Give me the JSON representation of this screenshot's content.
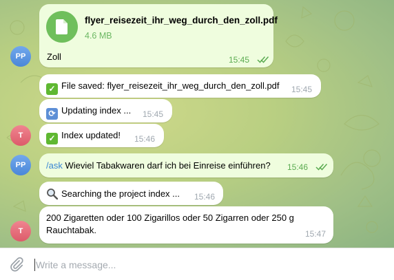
{
  "messages": {
    "file": {
      "filename": "flyer_reisezeit_ihr_weg_durch_den_zoll.pdf",
      "size": "4.6 MB",
      "caption": "Zoll",
      "time": "15:45",
      "avatar": "PP"
    },
    "saved": {
      "text": "File saved: flyer_reisezeit_ihr_weg_durch_den_zoll.pdf",
      "time": "15:45"
    },
    "updating": {
      "text": "Updating index ...",
      "time": "15:45"
    },
    "updated": {
      "text": "Index updated!",
      "time": "15:46",
      "avatar": "T"
    },
    "question": {
      "command": "/ask",
      "text": "Wieviel Tabakwaren darf ich bei Einreise einführen?",
      "time": "15:46",
      "avatar": "PP"
    },
    "searching": {
      "text": "Searching the project index ...",
      "time": "15:46"
    },
    "answer": {
      "line1": "200 Zigaretten oder 100 Zigarillos oder 50 Zigarren oder 250 g",
      "line2": "Rauchtabak.",
      "time": "15:47",
      "avatar": "T"
    }
  },
  "composer": {
    "placeholder": "Write a message..."
  },
  "icons": {
    "attach": "paperclip-icon",
    "file": "document-icon",
    "read": "double-check-icon",
    "saved_emoji": "check-mark-emoji",
    "updating_emoji": "arrows-cycle-emoji",
    "search_emoji": "magnifier-emoji"
  },
  "colors": {
    "outgoing_bubble": "#effdde",
    "incoming_bubble": "#ffffff",
    "link": "#3a86d4",
    "read_check": "#5aab50"
  }
}
